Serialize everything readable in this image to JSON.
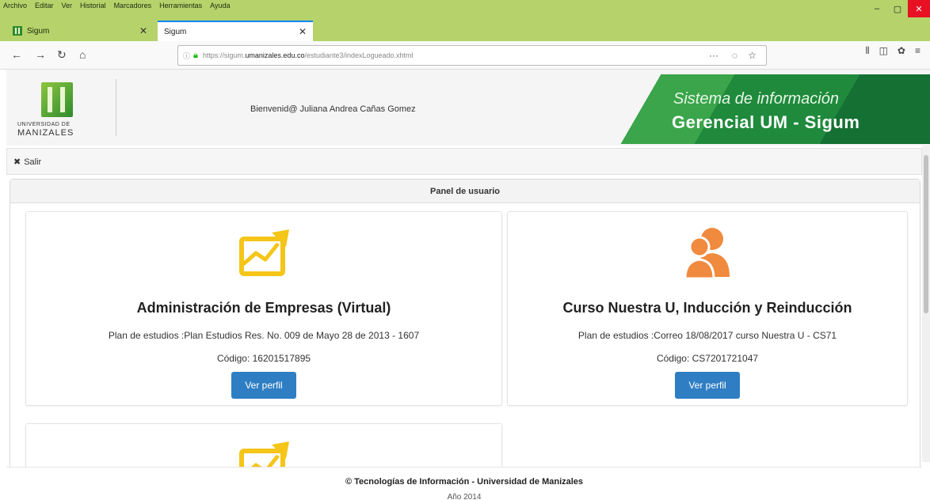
{
  "browser": {
    "menu": [
      "Archivo",
      "Editar",
      "Ver",
      "Historial",
      "Marcadores",
      "Herramientas",
      "Ayuda"
    ],
    "tabs": [
      {
        "title": "Sigum"
      },
      {
        "title": "Sigum"
      }
    ],
    "url_prefix": "https://sigum.",
    "url_domain": "umanizales.edu.co",
    "url_path": "/estudiante3/indexLogueado.xhtml",
    "accent": "#0a84ff",
    "titlebar_color": "#b5d36a"
  },
  "header": {
    "logo_line1": "UNIVERSIDAD DE",
    "logo_line2": "MANIZALES",
    "welcome": "Bienvenid@ Juliana Andrea Cañas Gomez",
    "banner_line1": "Sistema de información",
    "banner_line2": "Gerencial UM - Sigum"
  },
  "toolbar": {
    "salir_icon": "✖",
    "salir_label": "Salir"
  },
  "panel": {
    "title": "Panel de usuario",
    "cards": [
      {
        "icon": "chart-icon",
        "icon_color": "#f5c518",
        "name": "Administración de Empresas (Virtual)",
        "plan": "Plan de estudios :Plan Estudios Res. No. 009 de Mayo 28 de 2013 - 1607",
        "code": "Código: 16201517895",
        "button": "Ver perfil"
      },
      {
        "icon": "users-icon",
        "icon_color": "#f08a3e",
        "name": "Curso Nuestra U, Inducción y Reinducción",
        "plan": "Plan de estudios :Correo 18/08/2017 curso Nuestra U - CS71",
        "code": "Código: CS7201721047",
        "button": "Ver perfil"
      },
      {
        "icon": "chart-icon",
        "icon_color": "#f5c518"
      }
    ]
  },
  "footer": {
    "line1": "© Tecnologías de Información - Universidad de Manizales",
    "line2": "Año 2014"
  },
  "colors": {
    "button": "#2f7ec3",
    "banner_green": "#1f8a3c"
  }
}
